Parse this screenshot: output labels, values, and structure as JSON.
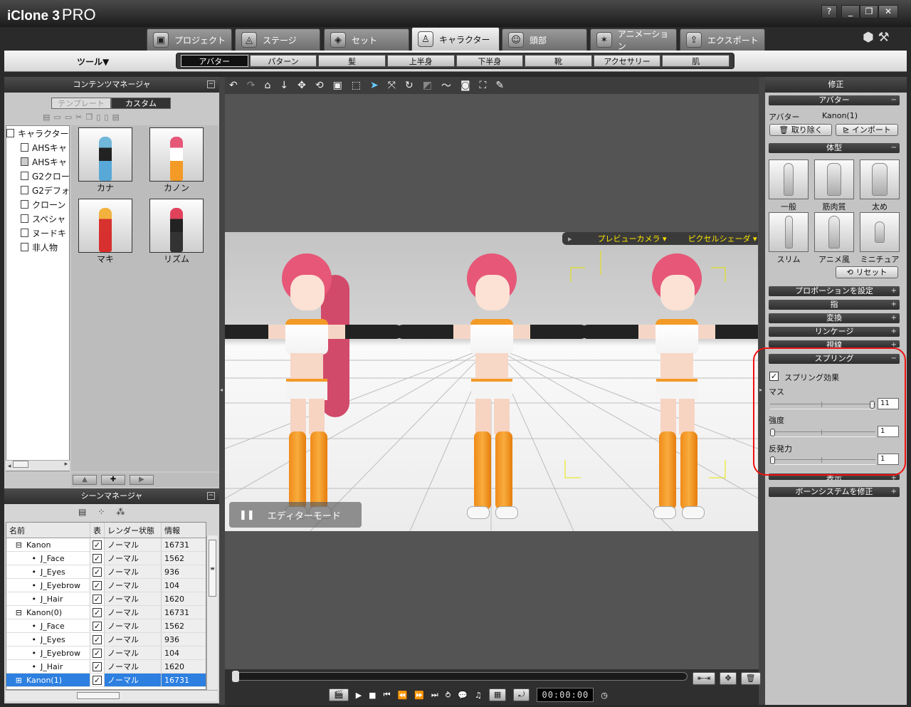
{
  "app": {
    "title": "iClone 3",
    "edition": "PRO"
  },
  "window_buttons": [
    "?",
    "_",
    "❐",
    "✕"
  ],
  "main_tabs": [
    {
      "label": "プロジェクト",
      "icon": "project-icon"
    },
    {
      "label": "ステージ",
      "icon": "stage-icon"
    },
    {
      "label": "セット",
      "icon": "set-icon"
    },
    {
      "label": "キャラクター",
      "icon": "character-icon",
      "active": true
    },
    {
      "label": "頭部",
      "icon": "head-icon"
    },
    {
      "label": "アニメーション",
      "icon": "animation-icon"
    },
    {
      "label": "エクスポート",
      "icon": "export-icon"
    }
  ],
  "tools_menu": "ツール▼",
  "sub_tabs": [
    {
      "label": "アバター",
      "active": true
    },
    {
      "label": "パターン"
    },
    {
      "label": "髪"
    },
    {
      "label": "上半身"
    },
    {
      "label": "下半身"
    },
    {
      "label": "靴"
    },
    {
      "label": "アクセサリー"
    },
    {
      "label": "肌"
    }
  ],
  "content_manager": {
    "title": "コンテンツマネージャ",
    "tabs": [
      "テンプレート",
      "カスタム"
    ],
    "tree": [
      "キャラクター",
      "AHSキャ",
      "AHSキャ",
      "G2クロー",
      "G2デフォ",
      "クローン",
      "スペシャ",
      "ヌードキ",
      "非人物"
    ],
    "thumbnails": [
      "カナ",
      "カノン",
      "マキ",
      "リズム"
    ]
  },
  "scene_manager": {
    "title": "シーンマネージャ",
    "columns": [
      "名前",
      "表",
      "レンダー状態",
      "情報"
    ],
    "rows": [
      {
        "name": "Kanon",
        "indent": 1,
        "prefix": "⊟",
        "visible": true,
        "render": "ノーマル",
        "info": "16731"
      },
      {
        "name": "J_Face",
        "indent": 2,
        "prefix": "•",
        "visible": true,
        "render": "ノーマル",
        "info": "1562"
      },
      {
        "name": "J_Eyes",
        "indent": 2,
        "prefix": "•",
        "visible": true,
        "render": "ノーマル",
        "info": "936"
      },
      {
        "name": "J_Eyebrow",
        "indent": 2,
        "prefix": "•",
        "visible": true,
        "render": "ノーマル",
        "info": "104"
      },
      {
        "name": "J_Hair",
        "indent": 2,
        "prefix": "•",
        "visible": true,
        "render": "ノーマル",
        "info": "1620"
      },
      {
        "name": "Kanon(0)",
        "indent": 1,
        "prefix": "⊟",
        "visible": true,
        "render": "ノーマル",
        "info": "16731"
      },
      {
        "name": "J_Face",
        "indent": 2,
        "prefix": "•",
        "visible": true,
        "render": "ノーマル",
        "info": "1562"
      },
      {
        "name": "J_Eyes",
        "indent": 2,
        "prefix": "•",
        "visible": true,
        "render": "ノーマル",
        "info": "936"
      },
      {
        "name": "J_Eyebrow",
        "indent": 2,
        "prefix": "•",
        "visible": true,
        "render": "ノーマル",
        "info": "104"
      },
      {
        "name": "J_Hair",
        "indent": 2,
        "prefix": "•",
        "visible": true,
        "render": "ノーマル",
        "info": "1620"
      },
      {
        "name": "Kanon(1)",
        "indent": 1,
        "prefix": "⊞",
        "visible": true,
        "render": "ノーマル",
        "info": "16731",
        "selected": true
      }
    ]
  },
  "viewport": {
    "camera": "プレビューカメラ",
    "shader": "ピクセルシェーダ",
    "mode": "エディターモード"
  },
  "playback": {
    "timecode": "00:00:00"
  },
  "modify_panel": {
    "title": "修正",
    "sections": {
      "avatar": "アバター",
      "body_type": "体型",
      "proportion": "プロポーションを設定",
      "finger": "指",
      "transform": "変換",
      "linkage": "リンケージ",
      "gaze": "視線",
      "spring": "スプリング",
      "display": "表示",
      "bone": "ボーンシステムを修正"
    },
    "avatar_label": "アバター",
    "avatar_value": "Kanon(1)",
    "remove_button": "取り除く",
    "import_button": "インポート",
    "body_types": [
      "一般",
      "筋肉質",
      "太め",
      "スリム",
      "アニメ風",
      "ミニチュア"
    ],
    "reset_button": "リセット",
    "spring_effect_label": "スプリング効果",
    "spring_effect_checked": true,
    "mass_label": "マス",
    "mass_value": "11",
    "mass_level": 1.0,
    "strength_label": "強度",
    "strength_value": "1",
    "strength_level": 0.0,
    "repulsion_label": "反発力",
    "repulsion_value": "1",
    "repulsion_level": 0.0
  },
  "colors": {
    "selection": "#2d7fe0",
    "highlight": "#e11111",
    "camera_text": "#ffe600"
  }
}
